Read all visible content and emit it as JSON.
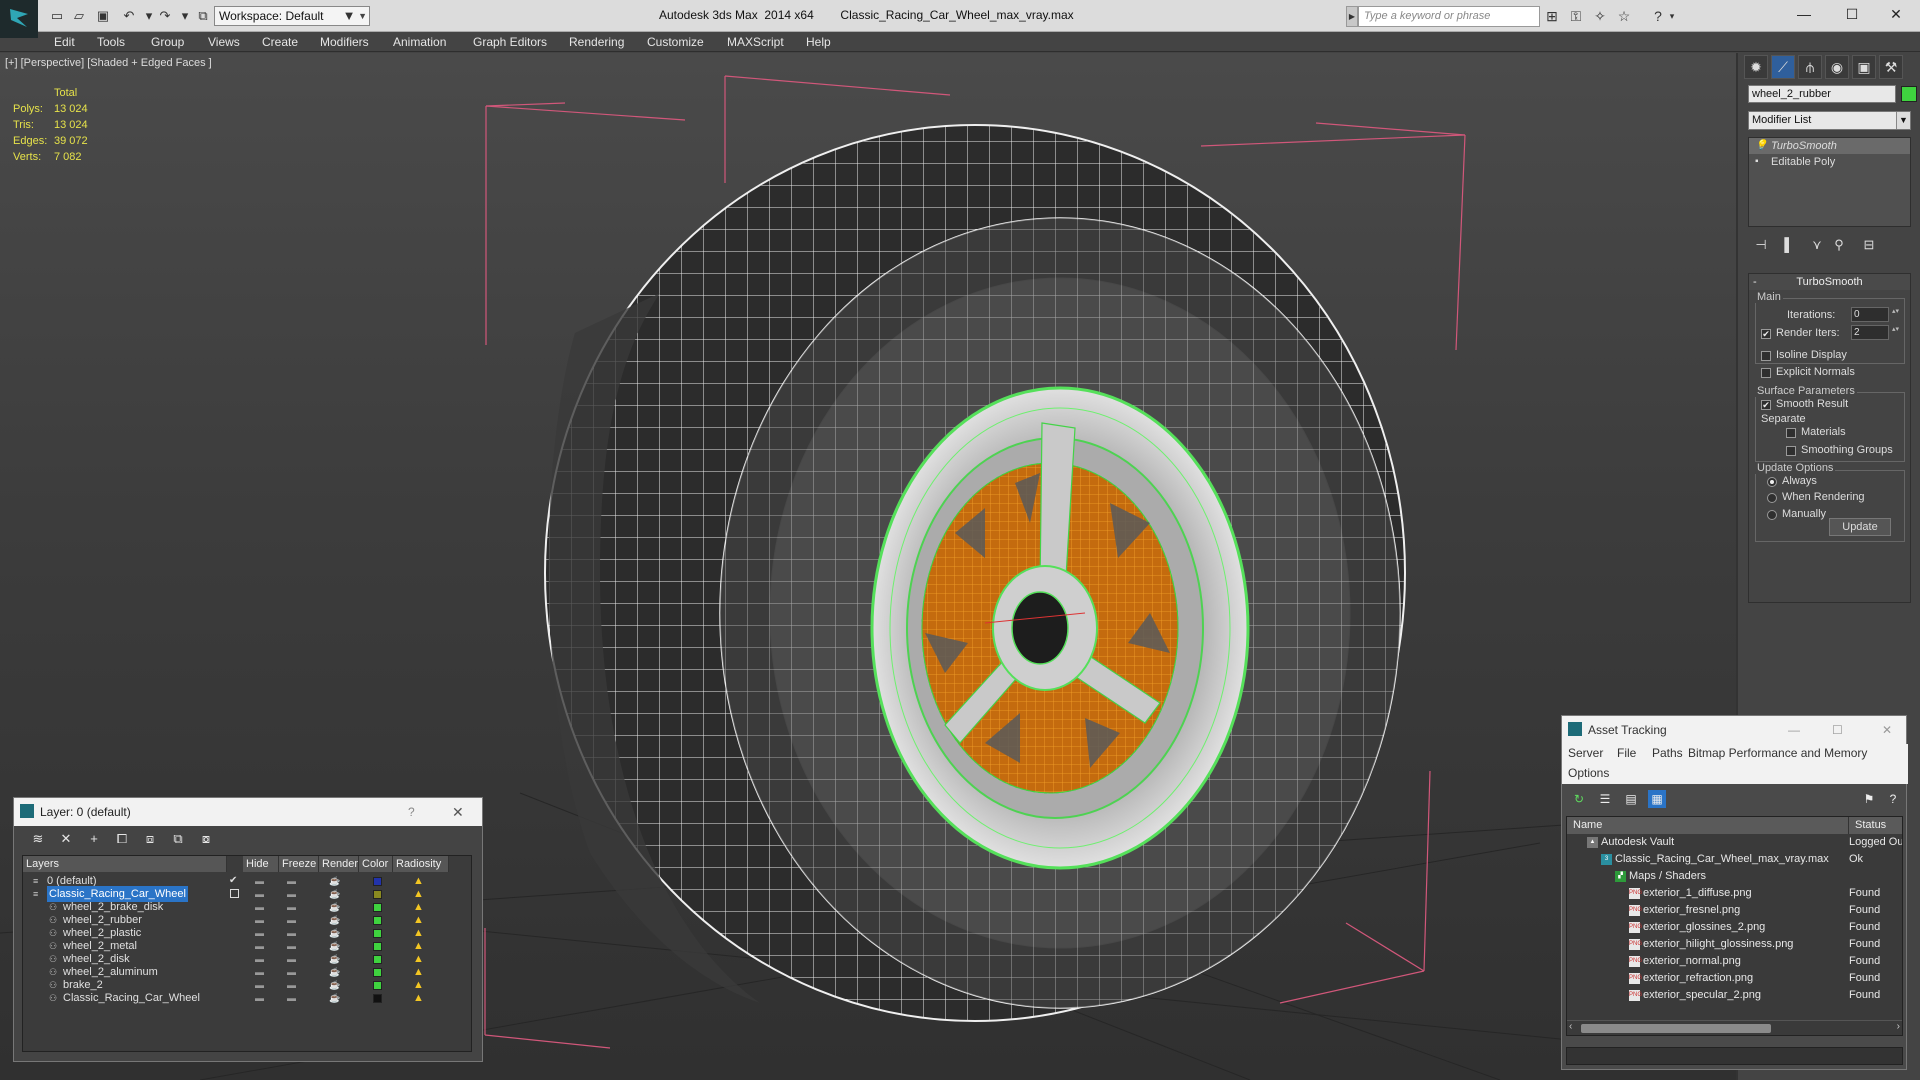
{
  "titlebar": {
    "workspace": "Workspace: Default",
    "title": "Autodesk 3ds Max  2014 x64        Classic_Racing_Car_Wheel_max_vray.max",
    "search_placeholder": "Type a keyword or phrase"
  },
  "menu": [
    "Edit",
    "Tools",
    "Group",
    "Views",
    "Create",
    "Modifiers",
    "Animation",
    "Graph Editors",
    "Rendering",
    "Customize",
    "MAXScript",
    "Help"
  ],
  "viewport": {
    "label": "[+] [Perspective] [Shaded + Edged Faces ]",
    "stats_header": "Total",
    "stats": [
      {
        "k": "Polys:",
        "v": "13 024"
      },
      {
        "k": "Tris:",
        "v": "13 024"
      },
      {
        "k": "Edges:",
        "v": "39 072"
      },
      {
        "k": "Verts:",
        "v": "7 082"
      }
    ]
  },
  "command_panel": {
    "object_name": "wheel_2_rubber",
    "object_color": "#3fd33f",
    "modifier_list": "Modifier List",
    "stack": [
      "TurboSmooth",
      "Editable Poly"
    ],
    "rollout_title": "TurboSmooth",
    "main_group": "Main",
    "iterations_label": "Iterations:",
    "iterations_value": "0",
    "render_iters_label": "Render Iters:",
    "render_iters_value": "2",
    "isoline": "Isoline Display",
    "explicit_normals": "Explicit Normals",
    "surface_group": "Surface Parameters",
    "smooth_result": "Smooth Result",
    "separate": "Separate",
    "materials": "Materials",
    "smoothing_groups": "Smoothing Groups",
    "update_group": "Update Options",
    "always": "Always",
    "when_rendering": "When Rendering",
    "manually": "Manually",
    "update_button": "Update"
  },
  "layer_manager": {
    "title": "Layer: 0 (default)",
    "question": "?",
    "headers": [
      "Layers",
      "Hide",
      "Freeze",
      "Render",
      "Color",
      "Radiosity"
    ],
    "rows": [
      {
        "name": "0 (default)",
        "color": "#2233aa",
        "indent": 0,
        "type": "layer",
        "check": "✔"
      },
      {
        "name": "Classic_Racing_Car_Wheel",
        "color": "#8a8a20",
        "indent": 0,
        "type": "layer",
        "selected": true
      },
      {
        "name": "wheel_2_brake_disk",
        "color": "#3fd33f",
        "indent": 1,
        "type": "obj"
      },
      {
        "name": "wheel_2_rubber",
        "color": "#3fd33f",
        "indent": 1,
        "type": "obj"
      },
      {
        "name": "wheel_2_plastic",
        "color": "#3fd33f",
        "indent": 1,
        "type": "obj"
      },
      {
        "name": "wheel_2_metal",
        "color": "#3fd33f",
        "indent": 1,
        "type": "obj"
      },
      {
        "name": "wheel_2_disk",
        "color": "#3fd33f",
        "indent": 1,
        "type": "obj"
      },
      {
        "name": "wheel_2_aluminum",
        "color": "#3fd33f",
        "indent": 1,
        "type": "obj"
      },
      {
        "name": "brake_2",
        "color": "#3fd33f",
        "indent": 1,
        "type": "obj"
      },
      {
        "name": "Classic_Racing_Car_Wheel",
        "color": "#111111",
        "indent": 1,
        "type": "obj"
      }
    ]
  },
  "asset_tracking": {
    "title": "Asset Tracking",
    "menu": [
      "Server",
      "File",
      "Paths",
      "Bitmap Performance and Memory",
      "Options"
    ],
    "headers": [
      "Name",
      "Status"
    ],
    "rows": [
      {
        "name": "Autodesk Vault",
        "status": "Logged Ou",
        "indent": 0,
        "icon": "vault"
      },
      {
        "name": "Classic_Racing_Car_Wheel_max_vray.max",
        "status": "Ok",
        "indent": 1,
        "icon": "max"
      },
      {
        "name": "Maps / Shaders",
        "status": "",
        "indent": 2,
        "icon": "maps"
      },
      {
        "name": "exterior_1_diffuse.png",
        "status": "Found",
        "indent": 3,
        "icon": "png"
      },
      {
        "name": "exterior_fresnel.png",
        "status": "Found",
        "indent": 3,
        "icon": "png"
      },
      {
        "name": "exterior_glossines_2.png",
        "status": "Found",
        "indent": 3,
        "icon": "png"
      },
      {
        "name": "exterior_hilight_glossiness.png",
        "status": "Found",
        "indent": 3,
        "icon": "png"
      },
      {
        "name": "exterior_normal.png",
        "status": "Found",
        "indent": 3,
        "icon": "png"
      },
      {
        "name": "exterior_refraction.png",
        "status": "Found",
        "indent": 3,
        "icon": "png"
      },
      {
        "name": "exterior_specular_2.png",
        "status": "Found",
        "indent": 3,
        "icon": "png"
      }
    ]
  }
}
